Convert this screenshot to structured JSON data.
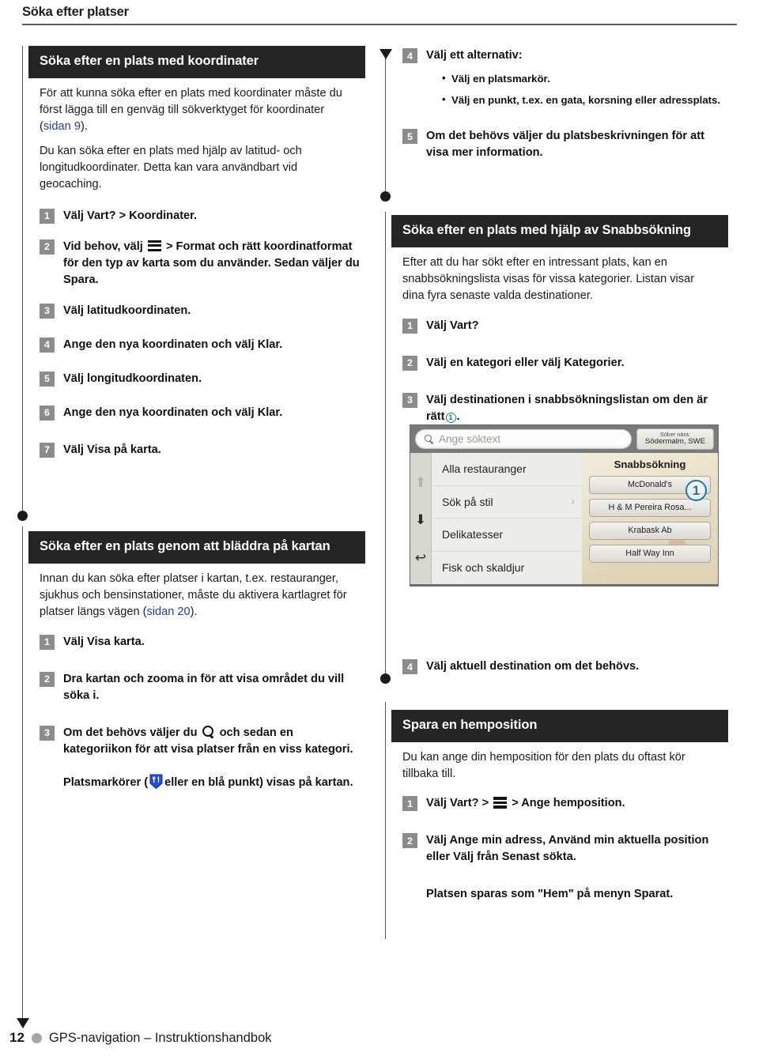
{
  "header": {
    "title": "Söka efter platser"
  },
  "left_column": {
    "section1": {
      "heading": "Söka efter en plats med koordinater",
      "paragraphs": [
        "För att kunna söka efter en plats med koordinater måste du först lägga till en genväg till sökverktyget för koordinater (sidan 9).",
        "Du kan söka efter en plats med hjälp av latitud- och longitudkoordinater. Detta kan vara användbart vid geocaching."
      ],
      "para1_pre": "För att kunna söka efter en plats med koordinater måste du först lägga till en genväg till sökverktyget för koordinater (",
      "para1_link": "sidan 9",
      "para1_post": ").",
      "para2": "Du kan söka efter en plats med hjälp av latitud- och longitudkoordinater. Detta kan vara användbart vid geocaching.",
      "steps": [
        {
          "num": "1",
          "text": "Välj Vart? > Koordinater."
        },
        {
          "num": "2",
          "pre": "Vid behov, välj",
          "icon": "hamburger-menu-icon",
          "post": "> Format och rätt koordinatformat för den typ av karta som du använder. Sedan väljer du Spara."
        },
        {
          "num": "3",
          "text": "Välj latitudkoordinaten."
        },
        {
          "num": "4",
          "text": "Ange den nya koordinaten och välj Klar."
        },
        {
          "num": "5",
          "text": "Välj longitudkoordinaten."
        },
        {
          "num": "6",
          "text": "Ange den nya koordinaten och välj Klar."
        },
        {
          "num": "7",
          "text": "Välj Visa på karta."
        }
      ]
    },
    "section2": {
      "heading": "Söka efter en plats genom att bläddra på kartan",
      "para_pre": "Innan du kan söka efter platser i kartan, t.ex. restauranger, sjukhus och bensinstationer, måste du aktivera kartlagret för platser längs vägen (",
      "para_link": "sidan 20",
      "para_post": ").",
      "steps": [
        {
          "num": "1",
          "text": "Välj Visa karta."
        },
        {
          "num": "2",
          "text": "Dra kartan och zooma in för att visa området du vill söka i."
        },
        {
          "num": "3",
          "pre": "Om det behövs väljer du",
          "icon": "search-icon",
          "post": "och sedan en kategoriikon för att visa platser från en viss kategori."
        }
      ],
      "note_pre": "Platsmarkörer (",
      "note_icon": "restaurant-map-pin-icon",
      "note_post": "eller en blå punkt) visas på kartan."
    }
  },
  "right_column": {
    "continued_steps": [
      {
        "num": "4",
        "text": "Välj ett alternativ:",
        "sub": [
          "Välj en platsmarkör.",
          "Välj en punkt, t.ex. en gata, korsning eller adressplats."
        ]
      },
      {
        "num": "5",
        "text": "Om det behövs väljer du platsbeskrivningen för att visa mer information."
      }
    ],
    "section3": {
      "heading": "Söka efter en plats med hjälp av Snabbsökning",
      "para": "Efter att du har sökt efter en intressant plats, kan en snabbsökningslista visas för vissa kategorier. Listan visar dina fyra senaste valda destinationer.",
      "steps": [
        {
          "num": "1",
          "text": "Välj Vart?"
        },
        {
          "num": "2",
          "text": "Välj en kategori eller välj Kategorier."
        },
        {
          "num": "3",
          "pre": "Välj destinationen i snabbsökningslistan om den är rätt",
          "callout": "1",
          "post": "."
        }
      ],
      "step4": {
        "num": "4",
        "text": "Välj aktuell destination om det behövs."
      }
    },
    "section4": {
      "heading": "Spara en hemposition",
      "para": "Du kan ange din hemposition för den plats du oftast kör tillbaka till.",
      "steps": [
        {
          "num": "1",
          "pre": "Välj Vart? >",
          "icon": "hamburger-menu-icon",
          "post": "> Ange hemposition."
        },
        {
          "num": "2",
          "text": "Välj Ange min adress, Använd min aktuella position eller Välj från Senast sökta."
        }
      ],
      "note": "Platsen sparas som \"Hem\" på menyn Sparat."
    }
  },
  "device_screenshot": {
    "search_placeholder": "Ange söktext",
    "near_button": {
      "line1": "Söker nära:",
      "line2": "Södermalm, SWE"
    },
    "nav_icons": [
      "scroll-up-icon",
      "scroll-down-icon",
      "back-icon"
    ],
    "categories": [
      {
        "label": "Alla restauranger",
        "chevron": false
      },
      {
        "label": "Sök på stil",
        "chevron": true
      },
      {
        "label": "Delikatesser",
        "chevron": false
      },
      {
        "label": "Fisk och skaldjur",
        "chevron": false
      }
    ],
    "quick_title": "Snabbsökning",
    "quick_items": [
      "McDonald's",
      "H & M Pereira Rosa...",
      "Krabask Ab",
      "Half Way Inn"
    ],
    "callout": "1"
  },
  "footer": {
    "page_number": "12",
    "text": "GPS-navigation – Instruktionshandbok"
  },
  "colors": {
    "heading_bar": "#252525",
    "step_badge": "#8c8c8c",
    "link": "#2b3aa0",
    "callout": "#1479b8",
    "rail": "#58585a"
  }
}
